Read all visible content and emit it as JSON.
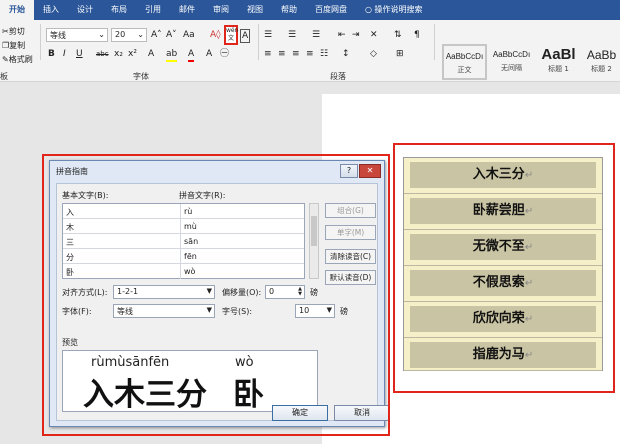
{
  "ribbon_tabs": [
    "开始",
    "插入",
    "设计",
    "布局",
    "引用",
    "邮件",
    "审阅",
    "视图",
    "帮助",
    "百度网盘",
    "操作说明搜索"
  ],
  "clipboard": {
    "cut": "剪切",
    "copy": "复制",
    "format_painter": "格式刷",
    "group_label": "板"
  },
  "font": {
    "name": "等线",
    "size": "20",
    "group_label": "字体",
    "phonetic_icon": "wén 文"
  },
  "paragraph": {
    "group_label": "段落"
  },
  "styles": [
    {
      "sample": "AaBbCcDı",
      "name": "正文"
    },
    {
      "sample": "AaBbCcDı",
      "name": "无间隔"
    },
    {
      "sample": "AaBl",
      "name": "标题 1"
    },
    {
      "sample": "AaBb",
      "name": "标题 2"
    }
  ],
  "dialog": {
    "title": "拼音指南",
    "help_btn": "?",
    "close_btn": "✕",
    "base_text_label": "基本文字(B):",
    "ruby_text_label": "拼音文字(R):",
    "rows": [
      {
        "base": "入",
        "ruby": "rù"
      },
      {
        "base": "木",
        "ruby": "mù"
      },
      {
        "base": "三",
        "ruby": "sān"
      },
      {
        "base": "分",
        "ruby": "fēn"
      },
      {
        "base": "卧",
        "ruby": "wò"
      }
    ],
    "buttons": {
      "group": "组合(G)",
      "mono": "单字(M)",
      "clear": "清除读音(C)",
      "default": "默认读音(D)"
    },
    "alignment_label": "对齐方式(L):",
    "alignment_value": "1-2-1",
    "offset_label": "偏移量(O):",
    "offset_value": "0",
    "offset_unit": "磅",
    "font_label": "字体(F):",
    "font_value": "等线",
    "size_label": "字号(S):",
    "size_value": "10",
    "size_unit": "磅",
    "preview_label": "预览",
    "preview_pinyin_1": "rùmùsānfēn",
    "preview_pinyin_2": "wò",
    "preview_text_1": "入木三分",
    "preview_text_2": "卧",
    "ok": "确定",
    "cancel": "取消"
  },
  "table_rows": [
    "入木三分",
    "卧薪尝胆",
    "无微不至",
    "不假思索",
    "欣欣向荣",
    "指鹿为马"
  ],
  "paragraph_mark": "↵"
}
